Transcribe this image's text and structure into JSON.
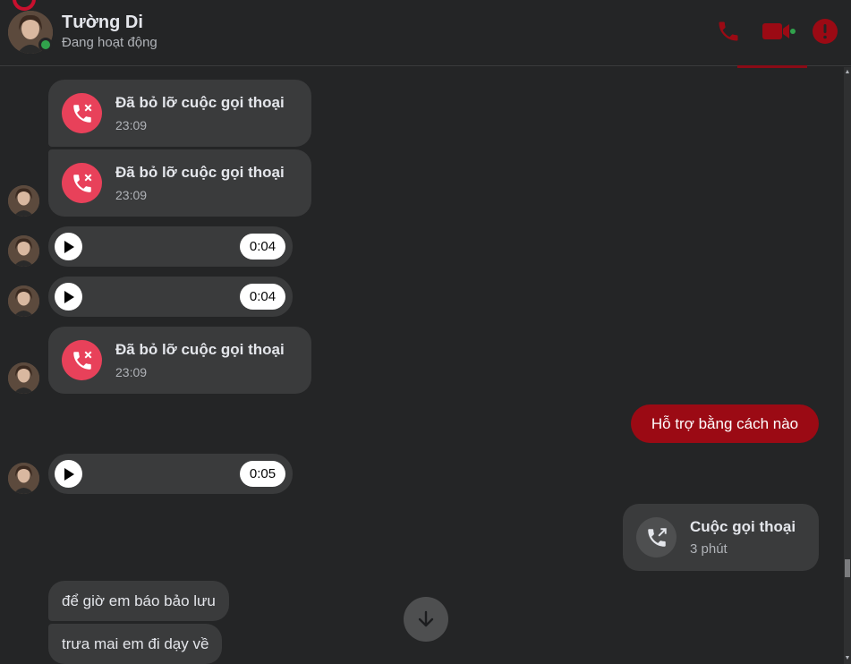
{
  "contact": {
    "name": "Tường Di",
    "status": "Đang hoạt động"
  },
  "header_icons": [
    "phone-icon",
    "video-camera-icon",
    "info-icon"
  ],
  "colors": {
    "accent": "#9b0a14",
    "missed_call": "#e8415a",
    "online": "#31a24c"
  },
  "messages": {
    "missed1": {
      "title": "Đã bỏ lỡ cuộc gọi thoại",
      "time": "23:09"
    },
    "missed2": {
      "title": "Đã bỏ lỡ cuộc gọi thoại",
      "time": "23:09"
    },
    "audio1": {
      "duration": "0:04"
    },
    "audio2": {
      "duration": "0:04"
    },
    "missed3": {
      "title": "Đã bỏ lỡ cuộc gọi thoại",
      "time": "23:09"
    },
    "sent1": {
      "text": "Hỗ trợ bằng cách nào"
    },
    "audio3": {
      "duration": "0:05"
    },
    "outgoing_call": {
      "title": "Cuộc gọi thoại",
      "length": "3 phút"
    },
    "text1": {
      "text": "để giờ em báo bảo lưu"
    },
    "text2": {
      "text": "trưa mai em đi dạy về"
    }
  }
}
